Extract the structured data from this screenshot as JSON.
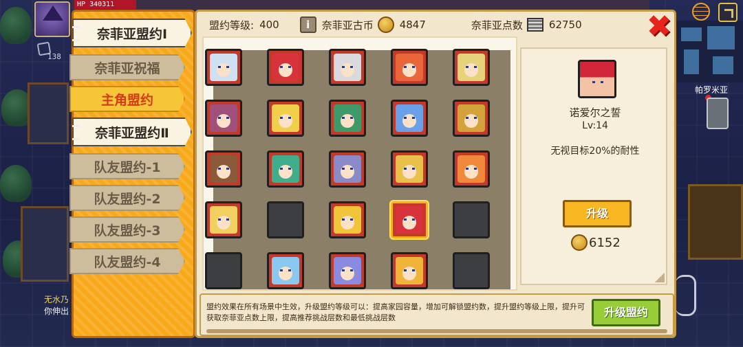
{
  "hud": {
    "hp_label": "HP",
    "hp_value": "340311",
    "bag_count": "138",
    "hint_line1": "无水乃",
    "hint_line2": "你伸出",
    "npc_name": "帕罗米亚"
  },
  "tabs": [
    {
      "label": "奈菲亚盟约Ⅰ",
      "state": "active"
    },
    {
      "label": "奈菲亚祝福",
      "state": "inactive"
    },
    {
      "label": "主角盟约",
      "state": "highlight"
    },
    {
      "label": "奈菲亚盟约Ⅱ",
      "state": "active-alt"
    },
    {
      "label": "队友盟约-1",
      "state": "inactive"
    },
    {
      "label": "队友盟约-2",
      "state": "inactive"
    },
    {
      "label": "队友盟约-3",
      "state": "inactive"
    },
    {
      "label": "队友盟约-4",
      "state": "inactive"
    }
  ],
  "header": {
    "level_label": "盟约等级:",
    "level_value": "400",
    "coin_label": "奈菲亚古币",
    "coin_value": "4847",
    "points_label": "奈菲亚点数",
    "points_value": "62750"
  },
  "grid": {
    "cells": [
      {
        "hair": "#cfe0f2",
        "locked": false
      },
      {
        "hair": "#d8323a",
        "locked": false
      },
      {
        "hair": "#d9d9de",
        "locked": false
      },
      {
        "hair": "#e8663a",
        "locked": false
      },
      {
        "hair": "#e6d27a",
        "locked": false
      },
      {
        "hair": "#a0507a",
        "locked": false
      },
      {
        "hair": "#f2cf4a",
        "locked": false
      },
      {
        "hair": "#3f9a6a",
        "locked": false
      },
      {
        "hair": "#6aa0e8",
        "locked": false
      },
      {
        "hair": "#d4a23a",
        "locked": false
      },
      {
        "hair": "#8a5a3a",
        "locked": false
      },
      {
        "hair": "#3fae8a",
        "locked": false
      },
      {
        "hair": "#8a8ac8",
        "locked": false
      },
      {
        "hair": "#e8c04a",
        "locked": false
      },
      {
        "hair": "#f08a3a",
        "locked": false
      },
      {
        "hair": "#f2d060",
        "locked": false
      },
      {
        "hair": "",
        "locked": true
      },
      {
        "hair": "#f2c43a",
        "locked": false
      },
      {
        "hair": "#d8323a",
        "locked": false,
        "selected": true
      },
      {
        "hair": "",
        "locked": true
      },
      {
        "hair": "",
        "locked": true
      },
      {
        "hair": "#8ac8f0",
        "locked": false
      },
      {
        "hair": "#8a8ae0",
        "locked": false
      },
      {
        "hair": "#f0b43a",
        "locked": false
      },
      {
        "hair": "",
        "locked": true
      }
    ]
  },
  "detail": {
    "name": "诺爱尔之誓",
    "level": "Lv:14",
    "description": "无视目标20%的耐性",
    "upgrade_label": "升级",
    "cost": "6152"
  },
  "footer": {
    "text": "盟约效果在所有场景中生效，升级盟约等级可以：提高家园容量，增加可解锁盟约数，提升盟约等级上限，提升可获取奈菲亚点数上限，提高推荐挑战层数和最低挑战层数",
    "button_label": "升级盟约"
  },
  "colors": {
    "accent": "#f7a91a",
    "close": "#e8231c",
    "upgrade": "#f7b622",
    "confirm": "#98cc38"
  }
}
